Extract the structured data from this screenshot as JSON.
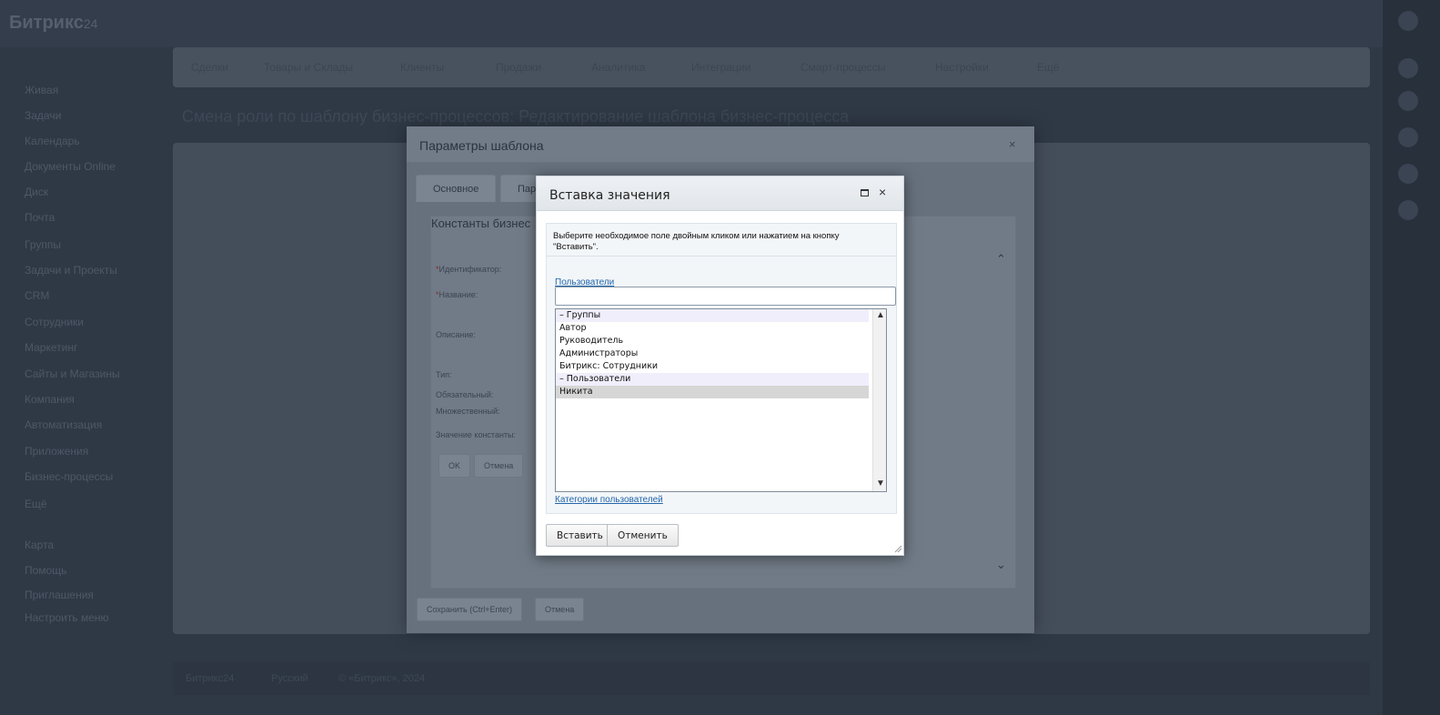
{
  "app": {
    "logo": "Битрикс",
    "logo_suffix": "24",
    "left_nav": [
      "Живая",
      "Задачи",
      "Календарь",
      "Документы Online",
      "Диск",
      "Почта",
      "Группы",
      "Задачи и Проекты",
      "CRM",
      "Сотрудники",
      "Маркетинг",
      "Сайты и Магазины",
      "Компания",
      "Автоматизация",
      "Приложения",
      "Бизнес-процессы",
      "Ещё",
      "Карта",
      "Помощь",
      "Приглашения",
      "Настроить меню"
    ],
    "top_menu": [
      "Сделки",
      "Товары и Склады",
      "Клиенты",
      "Продажи",
      "Аналитика",
      "Интеграции",
      "Смарт-процессы",
      "Настройки",
      "Ещё"
    ],
    "page_title": "Смена роли по шаблону бизнес-процессов: Редактирование шаблона бизнес-процесса",
    "footer": [
      "Битрикс24",
      "Русский",
      "© «Битрикс», 2024"
    ]
  },
  "params_dialog": {
    "title": "Параметры шаблона",
    "close": "×",
    "tabs": [
      "Основное",
      "Пара"
    ],
    "section_heading": "Константы бизнес",
    "fields": [
      {
        "label": "Идентификатор:",
        "required": true
      },
      {
        "label": "Название:",
        "required": true
      },
      {
        "label": "Описание:",
        "required": false
      },
      {
        "label": "Тип:",
        "required": false
      },
      {
        "label": "Обязательный:",
        "required": false
      },
      {
        "label": "Множественный:",
        "required": false
      },
      {
        "label": "Значение константы:",
        "required": false
      }
    ],
    "ok_label": "OK",
    "cancel_label": "Отмена",
    "save_label": "Сохранить (Ctrl+Enter)",
    "footer_cancel_label": "Отмена"
  },
  "insert_dialog": {
    "title": "Вставка значения",
    "hint": "Выберите необходимое поле двойным кликом или нажатием на кнопку \"Вставить\".",
    "users_link": "Пользователи",
    "search_value": "",
    "list_items": [
      {
        "text": "– Группы",
        "kind": "group"
      },
      {
        "text": "Автор",
        "kind": "item"
      },
      {
        "text": "Руководитель",
        "kind": "item"
      },
      {
        "text": "Администраторы",
        "kind": "item"
      },
      {
        "text": "Битрикс: Сотрудники",
        "kind": "item"
      },
      {
        "text": "– Пользователи",
        "kind": "group"
      },
      {
        "text": "Никита",
        "kind": "selected"
      }
    ],
    "categories_link": "Категории пользователей",
    "insert_label": "Вставить",
    "cancel_label": "Отменить",
    "close_glyph": "×"
  }
}
